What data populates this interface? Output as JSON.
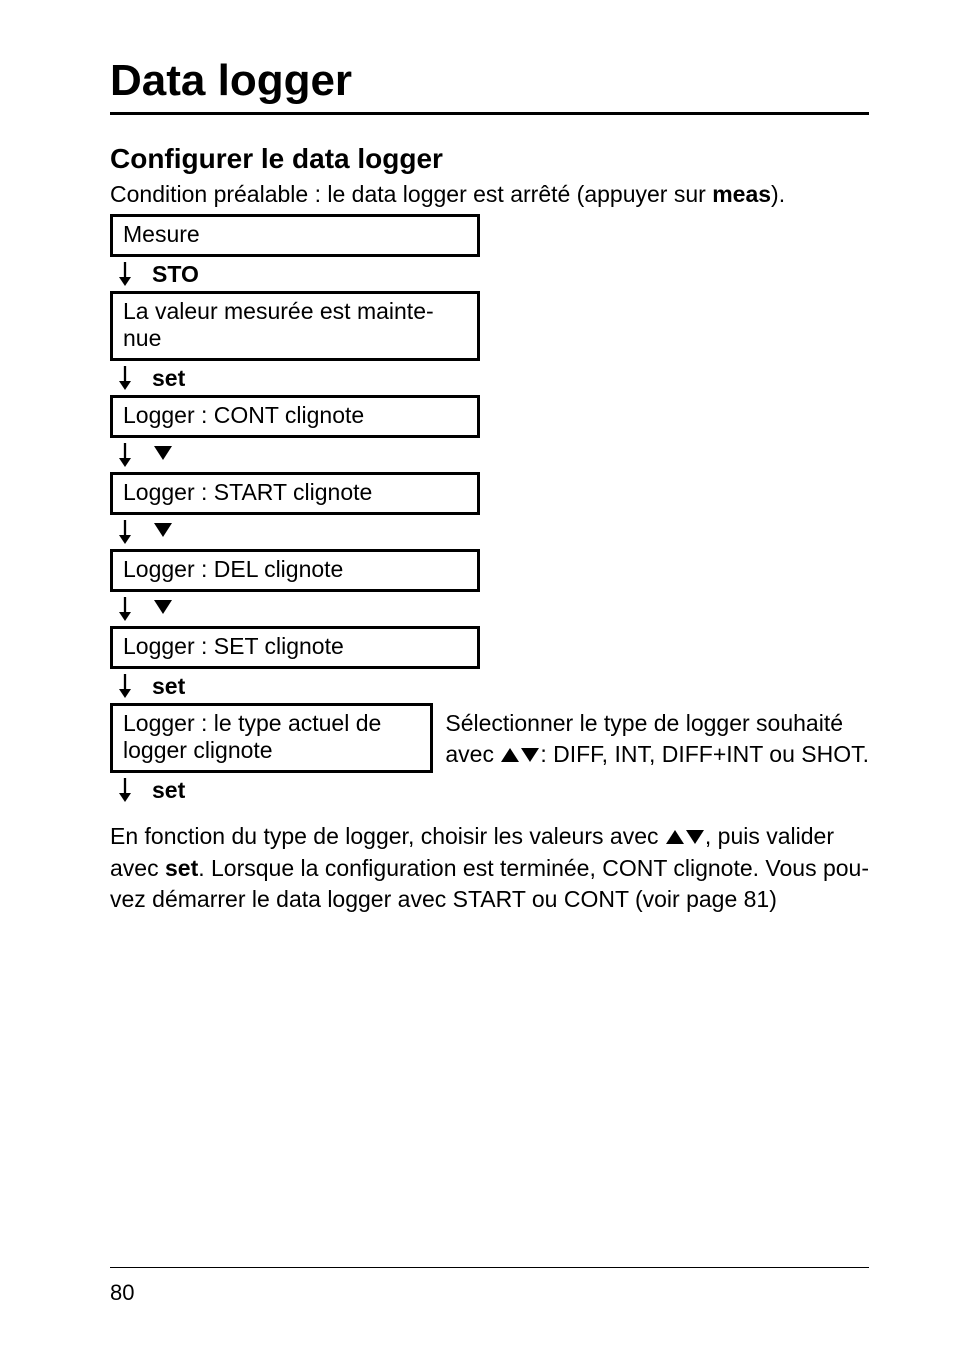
{
  "pageNumber": "80",
  "title": "Data logger",
  "h2": "Configurer le data logger",
  "condition_pre": "Condition préalable : le data logger est arrêté (appuyer sur ",
  "condition_bold": "meas",
  "condition_post": ").",
  "cells": {
    "mesure": "Mesure",
    "maintenue": "La valeur mesurée est mainte-\nnue",
    "cont": "Logger : CONT clignote",
    "start": "Logger : START clignote",
    "del": "Logger : DEL clignote",
    "setc": "Logger : SET clignote",
    "type": "Logger : le type actuel de logger clignote"
  },
  "steps": {
    "sto": "STO",
    "set": "set"
  },
  "side": {
    "line1": "Sélectionner le type de logger souhaité",
    "line2_pre": "avec ",
    "line2_post": ": DIFF, INT, DIFF+INT ou SHOT."
  },
  "para": {
    "p1_pre": "En fonction du type de logger, choisir les valeurs avec ",
    "p1_post": ", puis valider avec ",
    "p1_bold": "set",
    "p1_tail": ". Lorsque la configuration est terminée, CONT clignote. Vous pou-\nvez démarrer le data logger avec START ou CONT (voir page 81)"
  }
}
